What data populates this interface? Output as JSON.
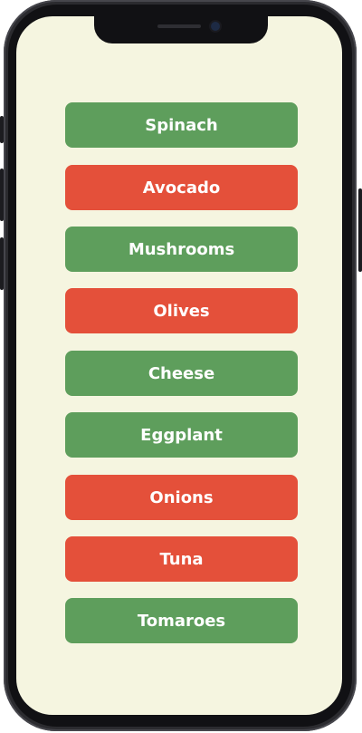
{
  "colors": {
    "screen_background": "#f5f5e0",
    "green": "#5e9e5c",
    "red": "#e4503a",
    "text": "#ffffff"
  },
  "items": [
    {
      "label": "Spinach",
      "color": "green"
    },
    {
      "label": "Avocado",
      "color": "red"
    },
    {
      "label": "Mushrooms",
      "color": "green"
    },
    {
      "label": "Olives",
      "color": "red"
    },
    {
      "label": "Cheese",
      "color": "green"
    },
    {
      "label": "Eggplant",
      "color": "green"
    },
    {
      "label": "Onions",
      "color": "red"
    },
    {
      "label": "Tuna",
      "color": "red"
    },
    {
      "label": "Tomaroes",
      "color": "green"
    }
  ]
}
